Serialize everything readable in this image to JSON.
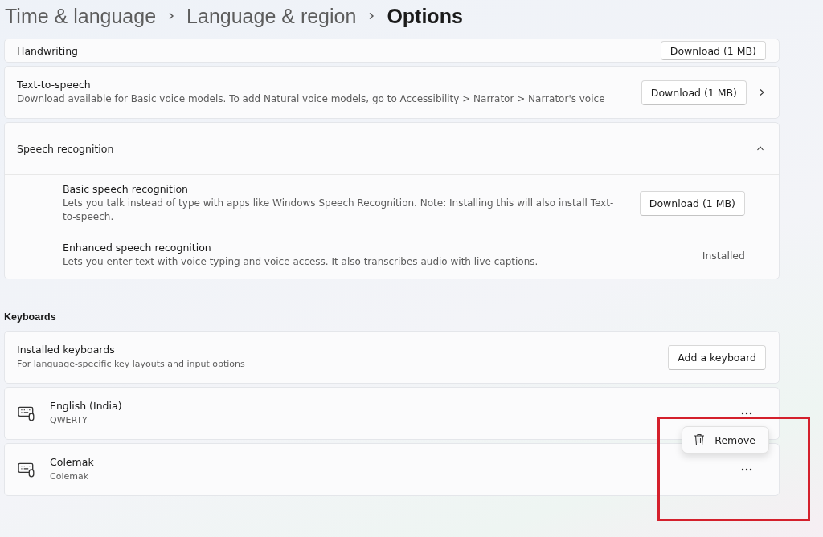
{
  "breadcrumb": [
    {
      "label": "Time & language",
      "current": false
    },
    {
      "label": "Language & region",
      "current": false
    },
    {
      "label": "Options",
      "current": true
    }
  ],
  "handwriting": {
    "title": "Handwriting",
    "button": "Download (1 MB)"
  },
  "text_to_speech": {
    "title": "Text-to-speech",
    "description": "Download available for Basic voice models. To add Natural voice models, go to Accessibility > Narrator > Narrator's voice",
    "button": "Download (1 MB)"
  },
  "speech_recognition": {
    "title": "Speech recognition",
    "expanded": true,
    "items": [
      {
        "kind": "download",
        "title": "Basic speech recognition",
        "description": "Lets you talk instead of type with apps like Windows Speech Recognition. Note: Installing this will also install Text-to-speech.",
        "action": "Download (1 MB)"
      },
      {
        "kind": "status",
        "title": "Enhanced speech recognition",
        "description": "Lets you enter text with voice typing and voice access. It also transcribes audio with live captions.",
        "action": "Installed"
      }
    ]
  },
  "keyboards": {
    "heading": "Keyboards",
    "installed": {
      "title": "Installed keyboards",
      "description": "For language-specific key layouts and input options",
      "button": "Add a keyboard"
    },
    "items": [
      {
        "name": "English (India)",
        "layout": "QWERTY",
        "context_menu": {
          "items": [
            "Remove"
          ]
        }
      },
      {
        "name": "Colemak",
        "layout": "Colemak"
      }
    ]
  }
}
